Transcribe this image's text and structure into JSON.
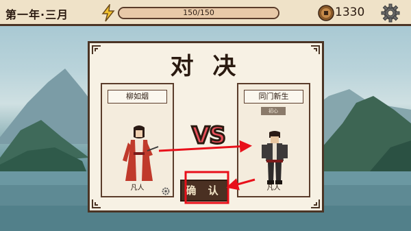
{
  "top_bar": {
    "date": "第一年·三月",
    "energy": {
      "current_text": "150/150",
      "fraction": 1.0
    },
    "coins": "1330",
    "icons": [
      "lightning-bolt-icon",
      "coin-icon",
      "gear-icon"
    ]
  },
  "duel": {
    "title": "对 决",
    "vs": "VS",
    "confirm_label": "确 认",
    "left": {
      "name": "柳如烟",
      "rank": "凡人"
    },
    "right": {
      "name": "同门新生",
      "tag": "初心",
      "rank": "凡人"
    }
  },
  "colors": {
    "panel": "#f7f1e4",
    "frame": "#4b3424",
    "vs": "#e84f5a",
    "highlight": "#e8101a"
  }
}
